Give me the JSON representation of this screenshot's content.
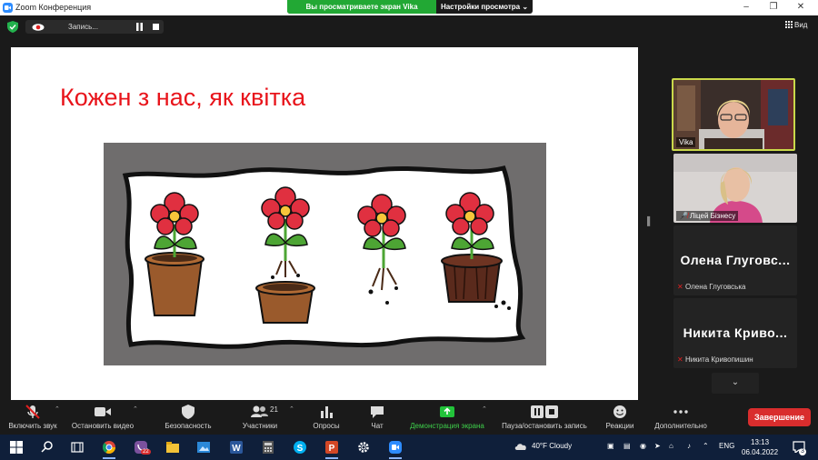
{
  "window": {
    "title": "Zoom Конференция",
    "controls": {
      "minimize": "–",
      "maximize": "❐",
      "close": "✕"
    }
  },
  "share_banner": {
    "status": "Вы просматриваете экран Vika",
    "view_options": "Настройки просмотра"
  },
  "recording": {
    "label": "Запись..."
  },
  "view_button": {
    "label": "Вид"
  },
  "slide": {
    "title": "Кожен з нас, як квітка"
  },
  "participants": [
    {
      "name": "Vika",
      "type": "video",
      "active": true
    },
    {
      "name": "Ліцей Бізнесу",
      "type": "video",
      "muted": true
    },
    {
      "display": "Олена  Глуговс...",
      "name": "Олена Глуговська",
      "type": "name",
      "muted": true
    },
    {
      "display": "Никита  Криво...",
      "name": "Никита Кривопишин",
      "type": "name",
      "muted": true
    }
  ],
  "toolbar": {
    "audio": "Включить звук",
    "video": "Остановить видео",
    "security": "Безопасность",
    "participants": "Участники",
    "participants_count": "21",
    "polls": "Опросы",
    "chat": "Чат",
    "share": "Демонстрация экрана",
    "record": "Пауза/остановить запись",
    "reactions": "Реакции",
    "more": "Дополнительно",
    "end": "Завершение"
  },
  "taskbar": {
    "weather": "40°F  Cloudy",
    "language": "ENG",
    "time": "13:13",
    "date": "06.04.2022",
    "viber_badge": "22",
    "notifications": "3"
  },
  "colors": {
    "title_red": "#e8141b",
    "share_green": "#22a834",
    "end_red": "#d92d2d",
    "active_border": "#c9d84a"
  }
}
